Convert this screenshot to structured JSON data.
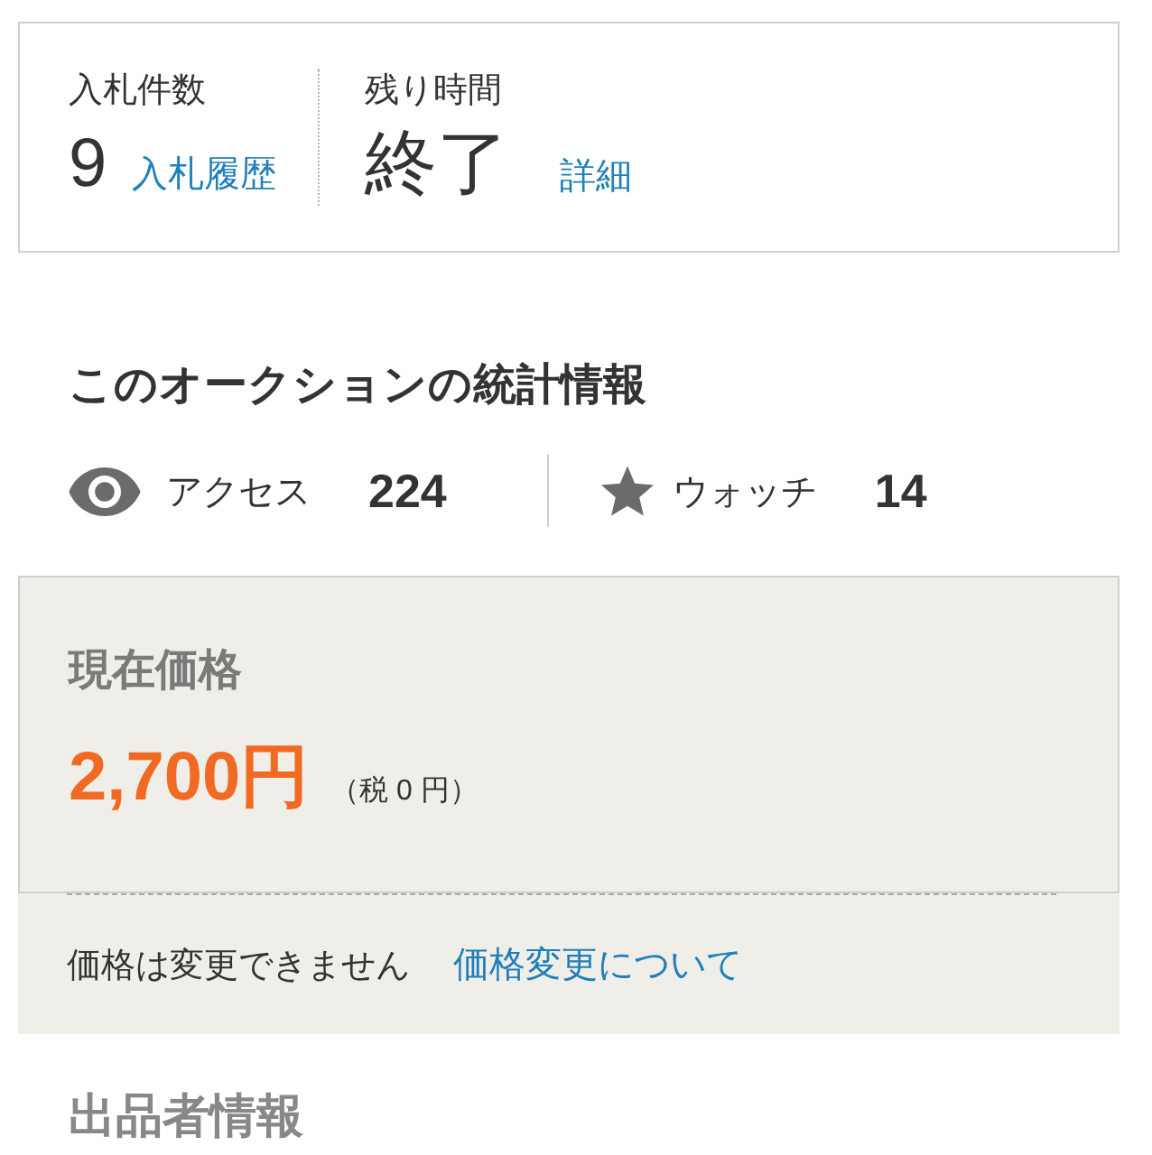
{
  "bid_summary": {
    "bids": {
      "label": "入札件数",
      "value": "9",
      "link": "入札履歴"
    },
    "time_left": {
      "label": "残り時間",
      "value": "終了",
      "link": "詳細"
    }
  },
  "statistics": {
    "title": "このオークションの統計情報",
    "items": [
      {
        "kind": "access",
        "label": "アクセス",
        "value": "224"
      },
      {
        "kind": "watch",
        "label": "ウォッチ",
        "value": "14"
      }
    ]
  },
  "price": {
    "label": "現在価格",
    "amount": "2,700円",
    "tax_note": "（税 0 円）",
    "notice": "価格は変更できません",
    "link": "価格変更について"
  },
  "seller_section": {
    "title": "出品者情報"
  }
}
